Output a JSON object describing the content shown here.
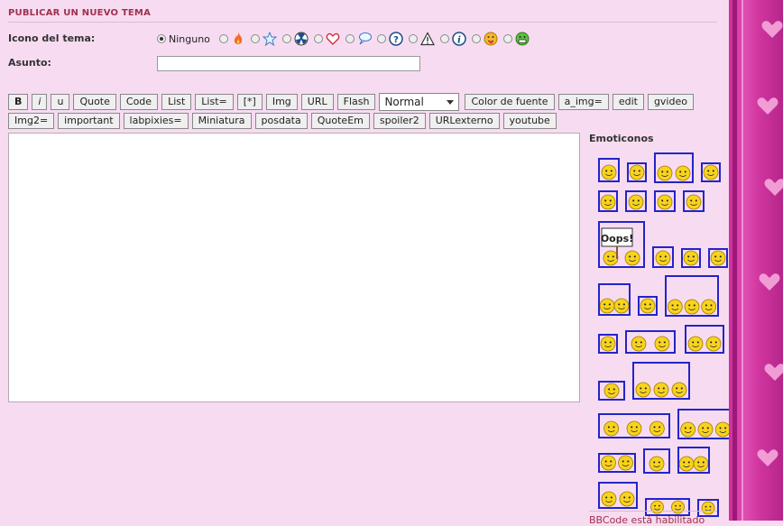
{
  "section_title": "PUBLICAR UN NUEVO TEMA",
  "icon_row": {
    "label": "Icono del tema:",
    "default_option": "Ninguno",
    "icons": [
      "fire-icon",
      "star-icon",
      "radioactive-icon",
      "heart-icon",
      "speech-bubble-icon",
      "question-icon",
      "warning-icon",
      "info-icon",
      "tongue-smiley-icon",
      "grin-smiley-icon"
    ]
  },
  "subject": {
    "label": "Asunto:",
    "value": ""
  },
  "toolbar_row1": [
    "B",
    "i",
    "u",
    "Quote",
    "Code",
    "List",
    "List=",
    "[*]",
    "Img",
    "URL",
    "Flash"
  ],
  "font_size_select": "Normal",
  "toolbar_row1_after": [
    "Color de fuente",
    "a_img=",
    "edit",
    "gvideo"
  ],
  "toolbar_row2": [
    "Img2=",
    "important",
    "labpixies=",
    "Miniatura",
    "posdata",
    "QuoteEm",
    "spoiler2",
    "URLexterno",
    "youtube"
  ],
  "message": "",
  "emoticons_title": "Emoticonos",
  "emoticon_sign_text": "Oops!",
  "emoticons": [
    "angel",
    "wink",
    "grin",
    "big-smile",
    "blush",
    "confused",
    "cool",
    "happy",
    "oops",
    "smile",
    "kiss",
    "dizzy",
    "shock",
    "frown",
    "fight",
    "angry",
    "hug",
    "scared",
    "devil",
    "bye",
    "sweat",
    "love",
    "silly",
    "laugh",
    "drunk",
    "dance",
    "clap",
    "yes",
    "flower",
    "rolleyes"
  ],
  "bottom_link": "BBCode está habilitado",
  "colors": {
    "accent": "#a0304f",
    "emoticon_border": "#2424c8",
    "page_bg": "#f7dcf1",
    "side_pink": "#d0369f"
  }
}
